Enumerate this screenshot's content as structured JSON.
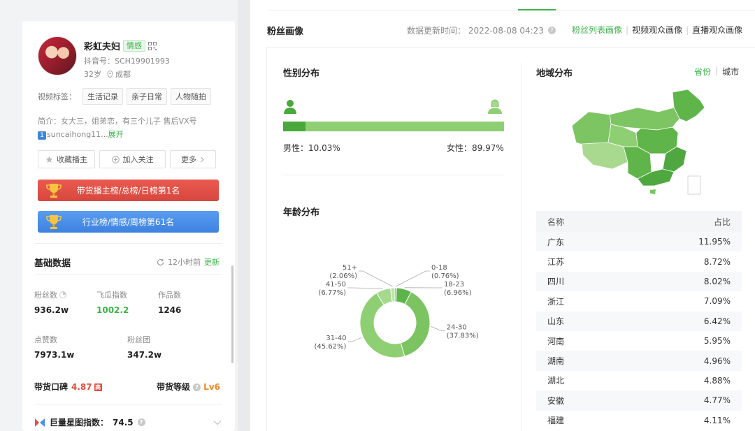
{
  "profile": {
    "name": "彩虹夫妇",
    "tag": "情感",
    "douyin_id": "抖音号：SCH19901993",
    "age": "32岁",
    "city": "成都"
  },
  "video_tags": {
    "label": "视频标签：",
    "items": [
      "生活记录",
      "亲子日常",
      "人物随拍"
    ]
  },
  "intro": {
    "text": "简介：女大三，姐弟恋，有三个儿子 售后VX号",
    "badge": "1",
    "handle": "suncaihong11...",
    "expand": "展开"
  },
  "buttons": {
    "collect": "收藏播主",
    "follow": "加入关注",
    "more": "更多"
  },
  "ranks": {
    "goods": "带货播主榜/总榜/日榜第1名",
    "industry": "行业榜/情感/周榜第61名"
  },
  "basic": {
    "title": "基础数据",
    "updated_ago": "12小时前",
    "update": "更新",
    "fans_label": "粉丝数",
    "fans": "936.2w",
    "feigua_label": "飞瓜指数",
    "feigua": "1002.2",
    "works_label": "作品数",
    "works": "1246",
    "likes_label": "点赞数",
    "likes": "7973.1w",
    "fan_group_label": "粉丝团",
    "fan_group": "347.2w",
    "kb_label": "带货口碑",
    "kb_value": "4.87",
    "kb_badge": "高",
    "level_label": "带货等级",
    "level": "Lv6",
    "juliang_label": "巨量星图指数：",
    "juliang": "74.5"
  },
  "fans_portrait": {
    "title": "粉丝画像",
    "update_time": "数据更新时间：  2022-08-08 04:23",
    "tabs": [
      "粉丝列表画像",
      "视频观众画像",
      "直播观众画像"
    ]
  },
  "gender": {
    "title": "性别分布",
    "male_label": "男性：",
    "male": "10.03%",
    "female_label": "女性：",
    "female": "89.97%",
    "male_fraction": 0.1003
  },
  "age": {
    "title": "年龄分布"
  },
  "chart_data": {
    "type": "pie",
    "categories": [
      "0-18",
      "18-23",
      "24-30",
      "31-40",
      "41-50",
      "51+"
    ],
    "values": [
      0.76,
      6.96,
      37.83,
      45.62,
      6.77,
      2.06
    ],
    "value_labels": [
      "(0.76%)",
      "(6.96%)",
      "(37.83%)",
      "(45.62%)",
      "(6.77%)",
      "(2.06%)"
    ],
    "colors": [
      "#4fa83f",
      "#5cb54a",
      "#7cc461",
      "#8fcf73",
      "#a6d98d",
      "#bfe3ab"
    ],
    "donut": true
  },
  "region": {
    "title": "地域分布",
    "toggle_province": "省份",
    "toggle_city": "城市",
    "col_name": "名称",
    "col_ratio": "占比",
    "rows": [
      {
        "name": "广东",
        "value": "11.95%"
      },
      {
        "name": "江苏",
        "value": "8.72%"
      },
      {
        "name": "四川",
        "value": "8.02%"
      },
      {
        "name": "浙江",
        "value": "7.09%"
      },
      {
        "name": "山东",
        "value": "6.42%"
      },
      {
        "name": "河南",
        "value": "5.95%"
      },
      {
        "name": "湖南",
        "value": "4.96%"
      },
      {
        "name": "湖北",
        "value": "4.88%"
      },
      {
        "name": "安徽",
        "value": "4.77%"
      },
      {
        "name": "福建",
        "value": "4.11%"
      }
    ]
  },
  "colors": {
    "accent": "#3bb34a",
    "map_dark": "#5fb54a",
    "map_light": "#a9d98f",
    "rank_red": "#e0524a",
    "rank_blue": "#4a8fe8"
  }
}
